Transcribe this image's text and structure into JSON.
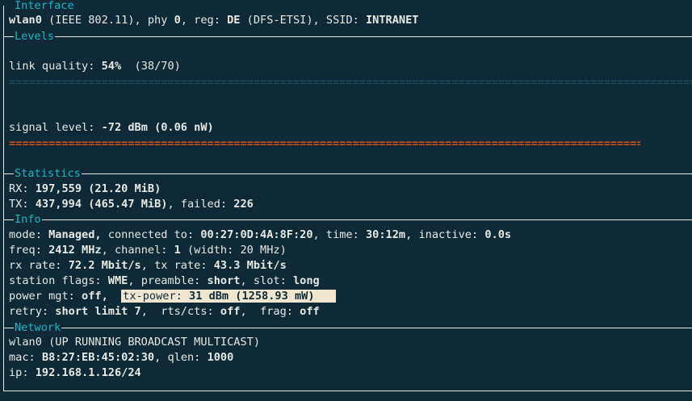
{
  "sections": {
    "interface": "Interface",
    "levels": "Levels",
    "statistics": "Statistics",
    "info": "Info",
    "network": "Network"
  },
  "interface": {
    "name": "wlan0",
    "standard": "(IEEE 802.11), phy",
    "phy": "0",
    "reg_label": ", reg:",
    "reg": "DE",
    "reg_extra": "(DFS-ETSI), SSID:",
    "ssid": "INTRANET"
  },
  "levels": {
    "link_quality_label": "link quality:",
    "link_quality_value": "54%",
    "link_quality_raw": "(38/70)",
    "link_quality_fraction": 0.54,
    "signal_label": "signal level:",
    "signal_value": "-72 dBm (0.06 nW)",
    "quality_bar_glyphs": "========================================================================================================",
    "signal_bar_glyphs": "======================================================================================================="
  },
  "statistics": {
    "rx_label": "RX:",
    "rx_value": "197,559 (21.20 MiB)",
    "tx_label": "TX:",
    "tx_value": "437,994 (465.47 MiB)",
    "failed_label": ", failed:",
    "failed_value": "226"
  },
  "info": {
    "mode_label": "mode:",
    "mode": "Managed,",
    "connected_label": "connected to:",
    "connected": "00:27:0D:4A:8F:20",
    "time_label": ", time:",
    "time": "30:12m",
    "inactive_label": ", inactive:",
    "inactive": "0.0s",
    "freq_label": "freq:",
    "freq": "2412 MHz",
    "channel_label": ", channel:",
    "channel": "1",
    "width_text": "(width: 20 MHz)",
    "rxrate_label": "rx rate:",
    "rxrate": "72.2 Mbit/s",
    "txrate_label": ", tx rate:",
    "txrate": "43.3 Mbit/s",
    "flags_label": "station flags:",
    "flags": "WME",
    "preamble_label": ", preamble:",
    "preamble": "short",
    "slot_label": ", slot:",
    "slot": "long",
    "powermgt_label": "power mgt:",
    "powermgt": "off,",
    "txpower_label": "tx-power:",
    "txpower": "31 dBm (1258.93 mW)",
    "retry_label": "retry:",
    "retry": "short limit 7",
    "rts_label": ",  rts/cts:",
    "rts": "off",
    "frag_label": ",  frag:",
    "frag": "off"
  },
  "network": {
    "iface": "wlan0",
    "flags": "(UP RUNNING BROADCAST MULTICAST)",
    "mac_label": "mac:",
    "mac": "B8:27:EB:45:02:30",
    "qlen_label": ", qlen:",
    "qlen": "1000",
    "ip_label": "ip:",
    "ip": "192.168.1.126/24"
  },
  "colors": {
    "background": "#0f2a36",
    "text": "#e7e8e2",
    "section_label": "#18b5c7",
    "signal_bar": "#d0521f",
    "quality_bar": "#1e4a5a",
    "highlight": "#efe6d2"
  }
}
